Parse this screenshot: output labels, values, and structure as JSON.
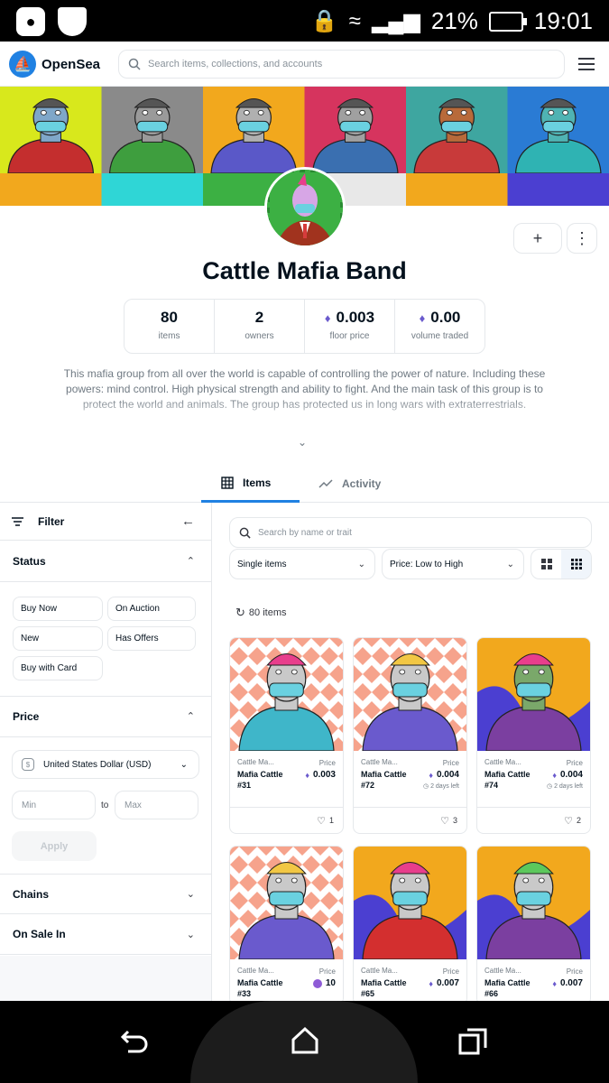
{
  "statusbar": {
    "battery": "21%",
    "time": "19:01"
  },
  "header": {
    "logo_text": "OpenSea",
    "search_placeholder": "Search items, collections, and accounts"
  },
  "collection": {
    "name": "Cattle Mafia Band",
    "stats": [
      {
        "value": "80",
        "label": "items",
        "eth": false
      },
      {
        "value": "2",
        "label": "owners",
        "eth": false
      },
      {
        "value": "0.003",
        "label": "floor price",
        "eth": true
      },
      {
        "value": "0.00",
        "label": "volume traded",
        "eth": true
      }
    ],
    "description": "This mafia group from all over the world is capable of controlling the power of nature. Including these powers: mind control. High physical strength and ability to fight. And the main task of this group is to protect the world and animals. The group has protected us in long wars with extraterrestrials."
  },
  "tabs": [
    {
      "label": "Items",
      "icon": "grid-icon",
      "active": true
    },
    {
      "label": "Activity",
      "icon": "activity-icon",
      "active": false
    }
  ],
  "sidebar": {
    "filter_label": "Filter",
    "status_label": "Status",
    "status_options": [
      "Buy Now",
      "On Auction",
      "New",
      "Has Offers",
      "Buy with Card"
    ],
    "price_label": "Price",
    "currency": "United States Dollar (USD)",
    "currency_symbol": "$",
    "min_placeholder": "Min",
    "to_label": "to",
    "max_placeholder": "Max",
    "apply_label": "Apply",
    "chains_label": "Chains",
    "on_sale_label": "On Sale In"
  },
  "main": {
    "search_placeholder": "Search by name or trait",
    "items_select": "Single items",
    "sort_select": "Price: Low to High",
    "count": "80 items"
  },
  "cards": [
    {
      "collection": "Cattle Ma...",
      "name": "Mafia Cattle",
      "number": "#31",
      "price_label": "Price",
      "price": "0.003",
      "currency": "eth",
      "time": "",
      "likes": "1",
      "bg": "#f6a38c",
      "bg2": "#ffffff",
      "hair": "#e83e8c",
      "shirt": "#3fb6c9",
      "face": "#c9c9c9",
      "pattern": "diamond"
    },
    {
      "collection": "Cattle Ma...",
      "name": "Mafia Cattle",
      "number": "#72",
      "price_label": "Price",
      "price": "0.004",
      "currency": "eth",
      "time": "2 days left",
      "likes": "3",
      "bg": "#f6a38c",
      "bg2": "#ffffff",
      "hair": "#f2c744",
      "shirt": "#6a5acd",
      "face": "#c9c9c9",
      "pattern": "diamond"
    },
    {
      "collection": "Cattle Ma...",
      "name": "Mafia Cattle",
      "number": "#74",
      "price_label": "Price",
      "price": "0.004",
      "currency": "eth",
      "time": "2 days left",
      "likes": "2",
      "bg": "#f2a81d",
      "bg2": "#4b3fd1",
      "hair": "#e83e8c",
      "shirt": "#7b3fa0",
      "face": "#7aa86a",
      "pattern": "paint"
    },
    {
      "collection": "Cattle Ma...",
      "name": "Mafia Cattle",
      "number": "#33",
      "price_label": "Price",
      "price": "10",
      "currency": "token",
      "time": "",
      "likes": "",
      "bg": "#f6a38c",
      "bg2": "#ffffff",
      "hair": "#f2c744",
      "shirt": "#6a5acd",
      "face": "#c9c9c9",
      "pattern": "diamond"
    },
    {
      "collection": "Cattle Ma...",
      "name": "Mafia Cattle",
      "number": "#65",
      "price_label": "Price",
      "price": "0.007",
      "currency": "eth",
      "time": "",
      "likes": "",
      "bg": "#f2a81d",
      "bg2": "#4b3fd1",
      "hair": "#e83e8c",
      "shirt": "#d32f2f",
      "face": "#c9c9c9",
      "pattern": "paint"
    },
    {
      "collection": "Cattle Ma...",
      "name": "Mafia Cattle",
      "number": "#66",
      "price_label": "Price",
      "price": "0.007",
      "currency": "eth",
      "time": "",
      "likes": "",
      "bg": "#f2a81d",
      "bg2": "#4b3fd1",
      "hair": "#5cc85c",
      "shirt": "#7b3fa0",
      "face": "#c9c9c9",
      "pattern": "paint"
    }
  ],
  "banner_tiles": [
    {
      "color": "#d8e81c",
      "shirt": "#c42e2e",
      "face": "#7fa7c9"
    },
    {
      "color": "#8a8a8a",
      "shirt": "#3e9e3e",
      "face": "#9a9a9a"
    },
    {
      "color": "#f2a81d",
      "shirt": "#5a58c8",
      "face": "#b0b0b0"
    },
    {
      "color": "#d6345e",
      "shirt": "#3a6fb0",
      "face": "#a0a0a0"
    },
    {
      "color": "#3ea6a0",
      "shirt": "#c83a3a",
      "face": "#b86a3a"
    },
    {
      "color": "#2a7bd4",
      "shirt": "#2fb3b3",
      "face": "#4fb3b3"
    }
  ],
  "colors": {
    "accent": "#2081e2",
    "eth": "#6a5acd",
    "border": "#e5e8eb"
  }
}
